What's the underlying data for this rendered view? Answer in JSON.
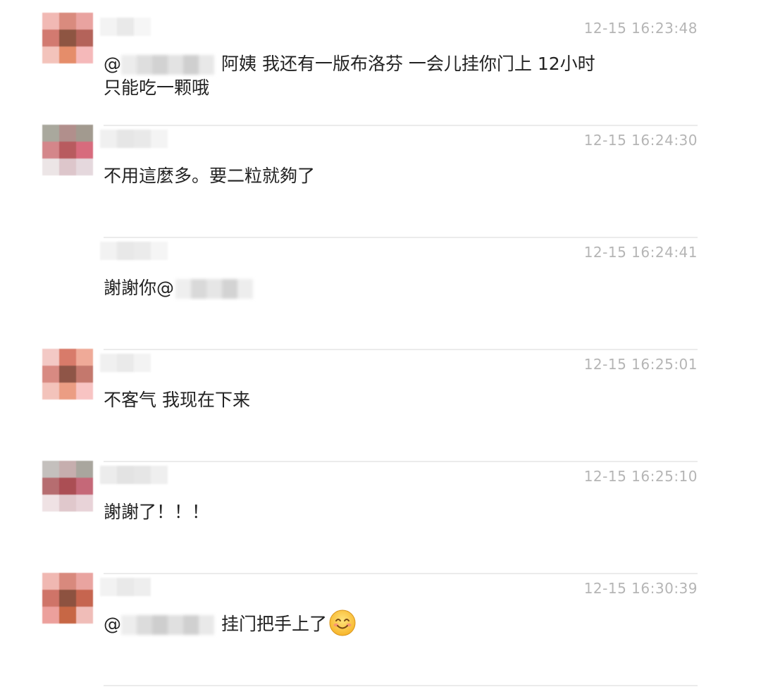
{
  "messages": [
    {
      "time": "12-15 16:23:48",
      "prefix": "@",
      "text": "阿姨   我还有一版布洛芬  一会儿挂你门上  12小时",
      "text2": "只能吃一颗哦",
      "avatar_colors": [
        "#f1b9b4",
        "#d98b7e",
        "#e9a3a0",
        "#d27a70",
        "#8e5542",
        "#b4635a",
        "#f3c3bb",
        "#e58d6a",
        "#f5b9ba"
      ],
      "name_colors": [
        "#f3f3f3",
        "#e9e9e9",
        "#f6f6f6"
      ]
    },
    {
      "time": "12-15 16:24:30",
      "text": "不用這麼多。要二粒就夠了",
      "avatar_colors": [
        "#a9a89d",
        "#b18f8c",
        "#a29a8f",
        "#d4868a",
        "#b85b5f",
        "#d76b7d",
        "#ece5e6",
        "#ddc6cb",
        "#e5d8dd"
      ],
      "name_colors": [
        "#f0f0f0",
        "#e6e6e6",
        "#e9e9e9",
        "#f4f4f4"
      ]
    },
    {
      "time": "12-15 16:24:41",
      "text": "謝謝你@",
      "avatar_colors": [],
      "name_colors": [
        "#f2f2f2",
        "#e8e8e8",
        "#ebebeb",
        "#f5f5f5"
      ]
    },
    {
      "time": "12-15 16:25:01",
      "text": "不客气  我现在下来",
      "avatar_colors": [
        "#f3c9c5",
        "#d87b6a",
        "#efaa98",
        "#d88a82",
        "#8f5547",
        "#c4786d",
        "#f3c3bb",
        "#eb9d83",
        "#f8c4c3"
      ],
      "name_colors": [
        "#f0f0f0",
        "#eaeaea",
        "#f3f3f3"
      ]
    },
    {
      "time": "12-15 16:25:10",
      "text": "謝謝了！！！",
      "avatar_colors": [
        "#c4c0bd",
        "#c6aeae",
        "#a9a69e",
        "#b66d70",
        "#ab4e54",
        "#c56878",
        "#efe2e4",
        "#e0c8cc",
        "#e8d3d8"
      ],
      "name_colors": [
        "#ececec",
        "#e3e3e3",
        "#e6e6e6",
        "#efefef"
      ]
    },
    {
      "time": "12-15 16:30:39",
      "prefix": "@",
      "text": "挂门把手上了",
      "emoji": "smiling-face-emoji",
      "avatar_colors": [
        "#f0b8b2",
        "#d8897d",
        "#e9a4a0",
        "#cf7468",
        "#8d5240",
        "#c6654f",
        "#eca09c",
        "#c76745",
        "#f0bdb8"
      ],
      "name_colors": [
        "#f2f2f2",
        "#e9e9e9",
        "#eeeeee"
      ]
    }
  ]
}
